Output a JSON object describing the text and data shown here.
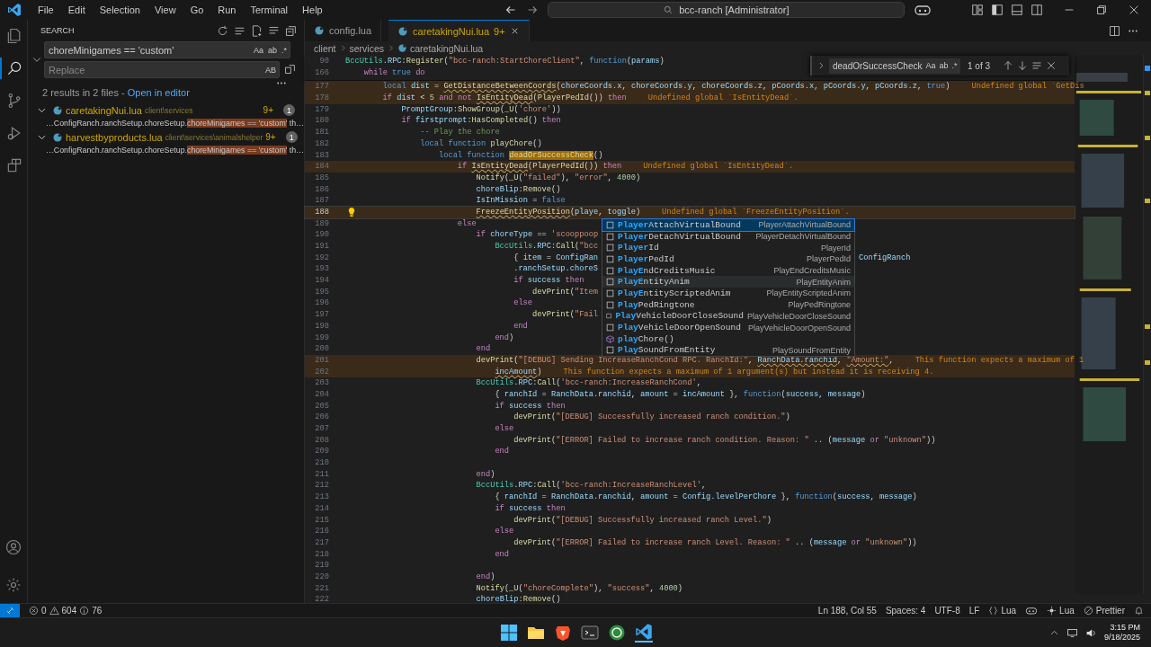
{
  "title_bar": {
    "menus": [
      "File",
      "Edit",
      "Selection",
      "View",
      "Go",
      "Run",
      "Terminal",
      "Help"
    ],
    "command_center": "bcc-ranch [Administrator]"
  },
  "activity_bar": {
    "items": [
      {
        "selected": false
      },
      {
        "selected": true
      },
      {
        "selected": false
      },
      {
        "selected": false
      },
      {
        "selected": false
      }
    ]
  },
  "sidebar": {
    "title": "SEARCH",
    "search": {
      "value": "choreMinigames == 'custom'",
      "options": [
        "Aa",
        "ab",
        ".*"
      ]
    },
    "replace": {
      "placeholder": "Replace",
      "option": "AB"
    },
    "summary": "2 results in 2 files - ",
    "open_link": "Open in editor",
    "files": [
      {
        "name": "caretakingNui.lua",
        "path": "client\\services",
        "badge": "9+",
        "count": "1",
        "expanded": true,
        "matches": [
          {
            "before": "…ConfigRanch.ranchSetup.choreSetup.",
            "match": "choreMinigames == 'custom'",
            "after": " th…"
          }
        ]
      },
      {
        "name": "harvestbyproducts.lua",
        "path": "client\\services\\animalshelper",
        "badge": "9+",
        "count": "1",
        "expanded": true,
        "matches": [
          {
            "before": "…ConfigRanch.ranchSetup.choreSetup.",
            "match": "choreMinigames == 'custom'",
            "after": " th…"
          }
        ]
      }
    ]
  },
  "tabs": [
    {
      "label": "config.lua",
      "selected": false
    },
    {
      "label": "caretakingNui.lua",
      "badge": "9+",
      "selected": true
    }
  ],
  "breadcrumbs": [
    "client",
    "services",
    "caretakingNui.lua"
  ],
  "find": {
    "value": "deadOrSuccessCheck",
    "options": [
      "Aa",
      "ab",
      ".*"
    ],
    "count": "1 of 3"
  },
  "sticky": [
    {
      "number": "90",
      "tokens": [
        {
          "kind": "ty",
          "text": "BccUtils"
        },
        {
          "kind": "pl",
          "text": "."
        },
        {
          "kind": "var",
          "text": "RPC"
        },
        {
          "kind": "pl",
          "text": ":"
        },
        {
          "kind": "fn",
          "text": "Register"
        },
        {
          "kind": "pl",
          "text": "("
        },
        {
          "kind": "str",
          "text": "\"bcc-ranch:StartChoreClient\""
        },
        {
          "kind": "pl",
          "text": ", "
        },
        {
          "kind": "kw",
          "text": "function"
        },
        {
          "kind": "pl",
          "text": "("
        },
        {
          "kind": "var",
          "text": "params"
        },
        {
          "kind": "pl",
          "text": ")"
        }
      ]
    },
    {
      "number": "166",
      "tokens": [
        {
          "kind": "ctl",
          "text": "\twhile "
        },
        {
          "kind": "kw",
          "text": "true "
        },
        {
          "kind": "ctl",
          "text": "do"
        }
      ]
    }
  ],
  "code": {
    "lines": [
      {
        "number": "177",
        "kind": "warning",
        "tokens": [
          {
            "kind": "kw",
            "text": "\t\tlocal "
          },
          {
            "kind": "var",
            "text": "dist "
          },
          {
            "kind": "pl",
            "text": "= "
          },
          {
            "kind": "fnwarn",
            "text": "GetDistanceBetweenCoords"
          },
          {
            "kind": "pl",
            "text": "("
          },
          {
            "kind": "var",
            "text": "choreCoords.x, choreCoords.y, choreCoords.z, pCoords.x, pCoords.y, pCoords.z, "
          },
          {
            "kind": "kw",
            "text": "true"
          },
          {
            "kind": "pl",
            "text": ")"
          }
        ],
        "diagnostic": "Undefined global `GetDis"
      },
      {
        "number": "178",
        "kind": "warning",
        "tokens": [
          {
            "kind": "ctl",
            "text": "\t\tif "
          },
          {
            "kind": "var",
            "text": "dist "
          },
          {
            "kind": "pl",
            "text": "< "
          },
          {
            "kind": "num",
            "text": "5 "
          },
          {
            "kind": "ctl",
            "text": "and not "
          },
          {
            "kind": "fnwarn",
            "text": "IsEntityDead"
          },
          {
            "kind": "pl",
            "text": "("
          },
          {
            "kind": "fn",
            "text": "PlayerPedId"
          },
          {
            "kind": "pl",
            "text": "()) "
          },
          {
            "kind": "ctl",
            "text": "then"
          }
        ],
        "diagnostic": "Undefined global `IsEntityDead`."
      },
      {
        "number": "179",
        "tokens": [
          {
            "kind": "var",
            "text": "\t\t\tPromptGroup"
          },
          {
            "kind": "pl",
            "text": ":"
          },
          {
            "kind": "fn",
            "text": "ShowGroup"
          },
          {
            "kind": "pl",
            "text": "("
          },
          {
            "kind": "fn",
            "text": "_U"
          },
          {
            "kind": "pl",
            "text": "("
          },
          {
            "kind": "str",
            "text": "'chore'"
          },
          {
            "kind": "pl",
            "text": "))"
          }
        ]
      },
      {
        "number": "180",
        "tokens": [
          {
            "kind": "ctl",
            "text": "\t\t\tif "
          },
          {
            "kind": "var",
            "text": "firstprompt"
          },
          {
            "kind": "pl",
            "text": ":"
          },
          {
            "kind": "fn",
            "text": "HasCompleted"
          },
          {
            "kind": "pl",
            "text": "() "
          },
          {
            "kind": "ctl",
            "text": "then"
          }
        ]
      },
      {
        "number": "181",
        "tokens": [
          {
            "kind": "cm",
            "text": "\t\t\t\t-- Play the chore"
          }
        ]
      },
      {
        "number": "182",
        "tokens": [
          {
            "kind": "kw",
            "text": "\t\t\t\tlocal function "
          },
          {
            "kind": "fn",
            "text": "playChore"
          },
          {
            "kind": "pl",
            "text": "()"
          }
        ]
      },
      {
        "number": "183",
        "tokens": [
          {
            "kind": "kw",
            "text": "\t\t\t\t\tlocal function "
          },
          {
            "kind": "fnfind",
            "text": "deadOrSuccessCheck"
          },
          {
            "kind": "pl",
            "text": "()"
          }
        ]
      },
      {
        "number": "184",
        "kind": "warning",
        "tokens": [
          {
            "kind": "ctl",
            "text": "\t\t\t\t\t\tif "
          },
          {
            "kind": "fnwarn",
            "text": "IsEntityDead"
          },
          {
            "kind": "pl",
            "text": "("
          },
          {
            "kind": "fn",
            "text": "PlayerPedId"
          },
          {
            "kind": "pl",
            "text": "()) "
          },
          {
            "kind": "ctl",
            "text": "then"
          }
        ],
        "diagnostic": "Undefined global `IsEntityDead`."
      },
      {
        "number": "185",
        "tokens": [
          {
            "kind": "fn",
            "text": "\t\t\t\t\t\t\tNotify"
          },
          {
            "kind": "pl",
            "text": "("
          },
          {
            "kind": "fn",
            "text": "_U"
          },
          {
            "kind": "pl",
            "text": "("
          },
          {
            "kind": "str",
            "text": "\"failed\""
          },
          {
            "kind": "pl",
            "text": "), "
          },
          {
            "kind": "str",
            "text": "\"error\""
          },
          {
            "kind": "pl",
            "text": ", "
          },
          {
            "kind": "num",
            "text": "4000"
          },
          {
            "kind": "pl",
            "text": ")"
          }
        ]
      },
      {
        "number": "186",
        "tokens": [
          {
            "kind": "var",
            "text": "\t\t\t\t\t\t\tchoreBlip"
          },
          {
            "kind": "pl",
            "text": ":"
          },
          {
            "kind": "fn",
            "text": "Remove"
          },
          {
            "kind": "pl",
            "text": "()"
          }
        ]
      },
      {
        "number": "187",
        "tokens": [
          {
            "kind": "var",
            "text": "\t\t\t\t\t\t\tIsInMission "
          },
          {
            "kind": "pl",
            "text": "= "
          },
          {
            "kind": "kw",
            "text": "false"
          }
        ]
      },
      {
        "number": "188",
        "kind": "current",
        "tokens": [
          {
            "kind": "fnwarn",
            "text": "\t\t\t\t\t\t\tFreezeEntityPosition"
          },
          {
            "kind": "pl",
            "text": "("
          },
          {
            "kind": "var",
            "text": "playe"
          },
          {
            "kind": "pl",
            "text": ", "
          },
          {
            "kind": "var",
            "text": "toggle"
          },
          {
            "kind": "pl",
            "text": ")"
          }
        ],
        "diagnostic": "Undefined global `FreezeEntityPosition`."
      },
      {
        "number": "189",
        "tokens": [
          {
            "kind": "ctl",
            "text": "\t\t\t\t\t\telse"
          }
        ]
      },
      {
        "number": "190",
        "tokens": [
          {
            "kind": "ctl",
            "text": "\t\t\t\t\t\t\tif "
          },
          {
            "kind": "var",
            "text": "choreType "
          },
          {
            "kind": "pl",
            "text": "== "
          },
          {
            "kind": "str",
            "text": "'scooppoop"
          }
        ]
      },
      {
        "number": "191",
        "tokens": [
          {
            "kind": "ty",
            "text": "\t\t\t\t\t\t\t\tBccUtils"
          },
          {
            "kind": "pl",
            "text": "."
          },
          {
            "kind": "var",
            "text": "RPC"
          },
          {
            "kind": "pl",
            "text": ":"
          },
          {
            "kind": "fn",
            "text": "Call"
          },
          {
            "kind": "pl",
            "text": "("
          },
          {
            "kind": "str",
            "text": "\"bcc"
          }
        ]
      },
      {
        "number": "192",
        "tokens": [
          {
            "kind": "pl",
            "text": "\t\t\t\t\t\t\t\t\t{ "
          },
          {
            "kind": "var",
            "text": "item "
          },
          {
            "kind": "pl",
            "text": "= "
          },
          {
            "kind": "var",
            "text": "ConfigRan"
          }
        ],
        "after_popup": "ConfigRanch"
      },
      {
        "number": "193",
        "tokens": [
          {
            "kind": "pl",
            "text": "\t\t\t\t\t\t\t\t\t."
          },
          {
            "kind": "var",
            "text": "ranchSetup"
          },
          {
            "kind": "pl",
            "text": "."
          },
          {
            "kind": "var",
            "text": "choreS"
          }
        ]
      },
      {
        "number": "194",
        "tokens": [
          {
            "kind": "ctl",
            "text": "\t\t\t\t\t\t\t\t\tif "
          },
          {
            "kind": "var",
            "text": "success "
          },
          {
            "kind": "ctl",
            "text": "then"
          }
        ]
      },
      {
        "number": "195",
        "tokens": [
          {
            "kind": "fn",
            "text": "\t\t\t\t\t\t\t\t\t\tdevPrint"
          },
          {
            "kind": "pl",
            "text": "("
          },
          {
            "kind": "str",
            "text": "\"Item"
          }
        ]
      },
      {
        "number": "196",
        "tokens": [
          {
            "kind": "ctl",
            "text": "\t\t\t\t\t\t\t\t\telse"
          }
        ]
      },
      {
        "number": "197",
        "tokens": [
          {
            "kind": "fn",
            "text": "\t\t\t\t\t\t\t\t\t\tdevPrint"
          },
          {
            "kind": "pl",
            "text": "("
          },
          {
            "kind": "str",
            "text": "\"Fail"
          }
        ]
      },
      {
        "number": "198",
        "tokens": [
          {
            "kind": "ctl",
            "text": "\t\t\t\t\t\t\t\t\tend"
          }
        ]
      },
      {
        "number": "199",
        "tokens": [
          {
            "kind": "ctl",
            "text": "\t\t\t\t\t\t\t\tend"
          },
          {
            "kind": "pl",
            "text": ")"
          }
        ]
      },
      {
        "number": "200",
        "tokens": [
          {
            "kind": "ctl",
            "text": "\t\t\t\t\t\t\tend"
          }
        ]
      },
      {
        "number": "201",
        "kind": "warning",
        "tokens": [
          {
            "kind": "fn",
            "text": "\t\t\t\t\t\t\tdevPrint"
          },
          {
            "kind": "pl",
            "text": "("
          },
          {
            "kind": "str",
            "text": "\"[DEBUG] Sending IncreaseRanchCond RPC. RanchId:\""
          },
          {
            "kind": "pl",
            "text": ", "
          },
          {
            "kind": "varwarn",
            "text": "RanchData.ranchid"
          },
          {
            "kind": "pl",
            "text": ", "
          },
          {
            "kind": "strwarn",
            "text": "\"Amount:\""
          },
          {
            "kind": "pl",
            "text": ","
          }
        ],
        "diagnostic": "This function expects a maximum of 1"
      },
      {
        "number": "202",
        "kind": "warning",
        "tokens": [
          {
            "kind": "varwarn",
            "text": "\t\t\t\t\t\t\t\tincAmount"
          },
          {
            "kind": "pl",
            "text": ")"
          }
        ],
        "diagnostic": "This function expects a maximum of 1 argument(s) but instead it is receiving 4."
      },
      {
        "number": "203",
        "tokens": [
          {
            "kind": "ty",
            "text": "\t\t\t\t\t\t\tBccUtils"
          },
          {
            "kind": "pl",
            "text": "."
          },
          {
            "kind": "var",
            "text": "RPC"
          },
          {
            "kind": "pl",
            "text": ":"
          },
          {
            "kind": "fn",
            "text": "Call"
          },
          {
            "kind": "pl",
            "text": "("
          },
          {
            "kind": "str",
            "text": "'bcc-ranch:IncreaseRanchCond'"
          },
          {
            "kind": "pl",
            "text": ","
          }
        ]
      },
      {
        "number": "204",
        "tokens": [
          {
            "kind": "pl",
            "text": "\t\t\t\t\t\t\t\t{ "
          },
          {
            "kind": "var",
            "text": "ranchId "
          },
          {
            "kind": "pl",
            "text": "= "
          },
          {
            "kind": "var",
            "text": "RanchData.ranchid"
          },
          {
            "kind": "pl",
            "text": ", "
          },
          {
            "kind": "var",
            "text": "amount "
          },
          {
            "kind": "pl",
            "text": "= "
          },
          {
            "kind": "var",
            "text": "incAmount "
          },
          {
            "kind": "pl",
            "text": "}, "
          },
          {
            "kind": "kw",
            "text": "function"
          },
          {
            "kind": "pl",
            "text": "("
          },
          {
            "kind": "var",
            "text": "success, message"
          },
          {
            "kind": "pl",
            "text": ")"
          }
        ]
      },
      {
        "number": "205",
        "tokens": [
          {
            "kind": "ctl",
            "text": "\t\t\t\t\t\t\t\tif "
          },
          {
            "kind": "var",
            "text": "success "
          },
          {
            "kind": "ctl",
            "text": "then"
          }
        ]
      },
      {
        "number": "206",
        "tokens": [
          {
            "kind": "fn",
            "text": "\t\t\t\t\t\t\t\t\tdevPrint"
          },
          {
            "kind": "pl",
            "text": "("
          },
          {
            "kind": "str",
            "text": "\"[DEBUG] Successfully increased ranch condition.\""
          },
          {
            "kind": "pl",
            "text": ")"
          }
        ]
      },
      {
        "number": "207",
        "tokens": [
          {
            "kind": "ctl",
            "text": "\t\t\t\t\t\t\t\telse"
          }
        ]
      },
      {
        "number": "208",
        "tokens": [
          {
            "kind": "fn",
            "text": "\t\t\t\t\t\t\t\t\tdevPrint"
          },
          {
            "kind": "pl",
            "text": "("
          },
          {
            "kind": "str",
            "text": "\"[ERROR] Failed to increase ranch condition. Reason: \""
          },
          {
            "kind": "pl",
            "text": " .. ("
          },
          {
            "kind": "var",
            "text": "message "
          },
          {
            "kind": "ctl",
            "text": "or "
          },
          {
            "kind": "str",
            "text": "\"unknown\""
          },
          {
            "kind": "pl",
            "text": "))"
          }
        ]
      },
      {
        "number": "209",
        "tokens": [
          {
            "kind": "ctl",
            "text": "\t\t\t\t\t\t\t\tend"
          }
        ]
      },
      {
        "number": "210"
      },
      {
        "number": "211",
        "tokens": [
          {
            "kind": "ctl",
            "text": "\t\t\t\t\t\t\tend"
          },
          {
            "kind": "pl",
            "text": ")"
          }
        ]
      },
      {
        "number": "212",
        "tokens": [
          {
            "kind": "ty",
            "text": "\t\t\t\t\t\t\tBccUtils"
          },
          {
            "kind": "pl",
            "text": "."
          },
          {
            "kind": "var",
            "text": "RPC"
          },
          {
            "kind": "pl",
            "text": ":"
          },
          {
            "kind": "fn",
            "text": "Call"
          },
          {
            "kind": "pl",
            "text": "("
          },
          {
            "kind": "str",
            "text": "'bcc-ranch:IncreaseRanchLevel'"
          },
          {
            "kind": "pl",
            "text": ","
          }
        ]
      },
      {
        "number": "213",
        "tokens": [
          {
            "kind": "pl",
            "text": "\t\t\t\t\t\t\t\t{ "
          },
          {
            "kind": "var",
            "text": "ranchId "
          },
          {
            "kind": "pl",
            "text": "= "
          },
          {
            "kind": "var",
            "text": "RanchData.ranchid"
          },
          {
            "kind": "pl",
            "text": ", "
          },
          {
            "kind": "var",
            "text": "amount "
          },
          {
            "kind": "pl",
            "text": "= "
          },
          {
            "kind": "var",
            "text": "Config.levelPerChore "
          },
          {
            "kind": "pl",
            "text": "}, "
          },
          {
            "kind": "kw",
            "text": "function"
          },
          {
            "kind": "pl",
            "text": "("
          },
          {
            "kind": "var",
            "text": "success, message"
          },
          {
            "kind": "pl",
            "text": ")"
          }
        ]
      },
      {
        "number": "214",
        "tokens": [
          {
            "kind": "ctl",
            "text": "\t\t\t\t\t\t\t\tif "
          },
          {
            "kind": "var",
            "text": "success "
          },
          {
            "kind": "ctl",
            "text": "then"
          }
        ]
      },
      {
        "number": "215",
        "tokens": [
          {
            "kind": "fn",
            "text": "\t\t\t\t\t\t\t\t\tdevPrint"
          },
          {
            "kind": "pl",
            "text": "("
          },
          {
            "kind": "str",
            "text": "\"[DEBUG] Successfully increased ranch Level.\""
          },
          {
            "kind": "pl",
            "text": ")"
          }
        ]
      },
      {
        "number": "216",
        "tokens": [
          {
            "kind": "ctl",
            "text": "\t\t\t\t\t\t\t\telse"
          }
        ]
      },
      {
        "number": "217",
        "tokens": [
          {
            "kind": "fn",
            "text": "\t\t\t\t\t\t\t\t\tdevPrint"
          },
          {
            "kind": "pl",
            "text": "("
          },
          {
            "kind": "str",
            "text": "\"[ERROR] Failed to increase ranch Level. Reason: \""
          },
          {
            "kind": "pl",
            "text": " .. ("
          },
          {
            "kind": "var",
            "text": "message "
          },
          {
            "kind": "ctl",
            "text": "or "
          },
          {
            "kind": "str",
            "text": "\"unknown\""
          },
          {
            "kind": "pl",
            "text": "))"
          }
        ]
      },
      {
        "number": "218",
        "tokens": [
          {
            "kind": "ctl",
            "text": "\t\t\t\t\t\t\t\tend"
          }
        ]
      },
      {
        "number": "219"
      },
      {
        "number": "220",
        "tokens": [
          {
            "kind": "ctl",
            "text": "\t\t\t\t\t\t\tend"
          },
          {
            "kind": "pl",
            "text": ")"
          }
        ]
      },
      {
        "number": "221",
        "tokens": [
          {
            "kind": "fn",
            "text": "\t\t\t\t\t\t\tNotify"
          },
          {
            "kind": "pl",
            "text": "("
          },
          {
            "kind": "fn",
            "text": "_U"
          },
          {
            "kind": "pl",
            "text": "("
          },
          {
            "kind": "str",
            "text": "\"choreComplete\""
          },
          {
            "kind": "pl",
            "text": "), "
          },
          {
            "kind": "str",
            "text": "\"success\""
          },
          {
            "kind": "pl",
            "text": ", "
          },
          {
            "kind": "num",
            "text": "4000"
          },
          {
            "kind": "pl",
            "text": ")"
          }
        ]
      },
      {
        "number": "222",
        "tokens": [
          {
            "kind": "var",
            "text": "\t\t\t\t\t\t\tchoreBlip"
          },
          {
            "kind": "pl",
            "text": ":"
          },
          {
            "kind": "fn",
            "text": "Remove"
          },
          {
            "kind": "pl",
            "text": "()"
          }
        ]
      }
    ]
  },
  "suggestions": [
    {
      "kind": "text",
      "match": "Player",
      "rest": "AttachVirtualBound",
      "detail": "PlayerAttachVirtualBound",
      "selected": true,
      "hovered": false
    },
    {
      "kind": "text",
      "match": "Player",
      "rest": "DetachVirtualBound",
      "detail": "PlayerDetachVirtualBound",
      "selected": false,
      "hovered": false
    },
    {
      "kind": "text",
      "match": "Player",
      "rest": "Id",
      "detail": "PlayerId",
      "selected": false,
      "hovered": false
    },
    {
      "kind": "text",
      "match": "Player",
      "rest": "PedId",
      "detail": "PlayerPedId",
      "selected": false,
      "hovered": false
    },
    {
      "kind": "text",
      "match": "PlayE",
      "rest": "ndCreditsMusic",
      "detail": "PlayEndCreditsMusic",
      "selected": false,
      "hovered": false
    },
    {
      "kind": "text",
      "match": "PlayE",
      "rest": "ntityAnim",
      "detail": "PlayEntityAnim",
      "selected": false,
      "hovered": true
    },
    {
      "kind": "text",
      "match": "PlayE",
      "rest": "ntityScriptedAnim",
      "detail": "PlayEntityScriptedAnim",
      "selected": false,
      "hovered": false
    },
    {
      "kind": "text",
      "match": "Play",
      "rest": "PedRingtone",
      "detail": "PlayPedRingtone",
      "selected": false,
      "hovered": false
    },
    {
      "kind": "text",
      "match": "Play",
      "rest": "VehicleDoorCloseSound",
      "detail": "PlayVehicleDoorCloseSound",
      "selected": false,
      "hovered": false
    },
    {
      "kind": "text",
      "match": "Play",
      "rest": "VehicleDoorOpenSound",
      "detail": "PlayVehicleDoorOpenSound",
      "selected": false,
      "hovered": false
    },
    {
      "kind": "method",
      "match": "play",
      "rest": "Chore()",
      "selected": false,
      "hovered": false
    },
    {
      "kind": "text",
      "match": "Play",
      "rest": "SoundFromEntity",
      "detail": "PlaySoundFromEntity",
      "selected": false,
      "hovered": false
    }
  ],
  "status_bar": {
    "errors": "0",
    "warnings": "604",
    "infos": "76",
    "position": "Ln 188, Col 55",
    "indent": "Spaces: 4",
    "encoding": "UTF-8",
    "eol": "LF",
    "language": "Lua",
    "lua_status": "Lua",
    "formatter": "Prettier"
  },
  "taskbar": {
    "time": "3:15 PM",
    "date": "9/18/2025"
  }
}
